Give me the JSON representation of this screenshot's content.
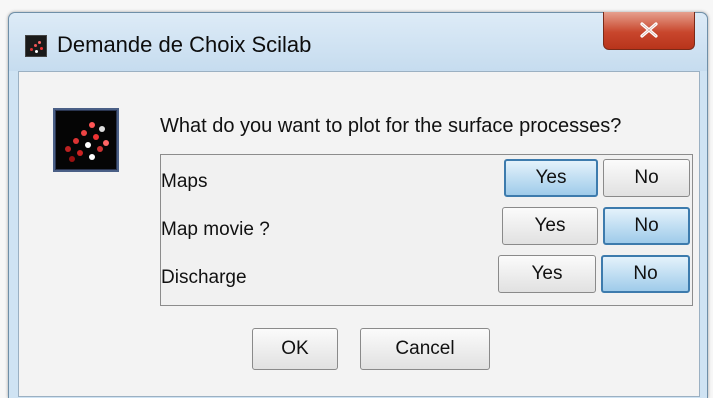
{
  "window": {
    "title": "Demande de Choix Scilab",
    "close_label": "close"
  },
  "dialog": {
    "question": "What do you want to plot for the surface processes?",
    "rows": [
      {
        "label": "Maps",
        "yes": "Yes",
        "no": "No",
        "selected": "Yes"
      },
      {
        "label": "Map movie ?",
        "yes": "Yes",
        "no": "No",
        "selected": "No"
      },
      {
        "label": "Discharge",
        "yes": "Yes",
        "no": "No",
        "selected": "No"
      }
    ],
    "ok_label": "OK",
    "cancel_label": "Cancel"
  },
  "colors": {
    "selected_button": "#9fcbea",
    "close_button": "#c8462c",
    "window_frame": "#cfe3f3"
  },
  "icons": [
    "scilab-app-icon",
    "close-icon",
    "scilab-dialog-icon"
  ]
}
